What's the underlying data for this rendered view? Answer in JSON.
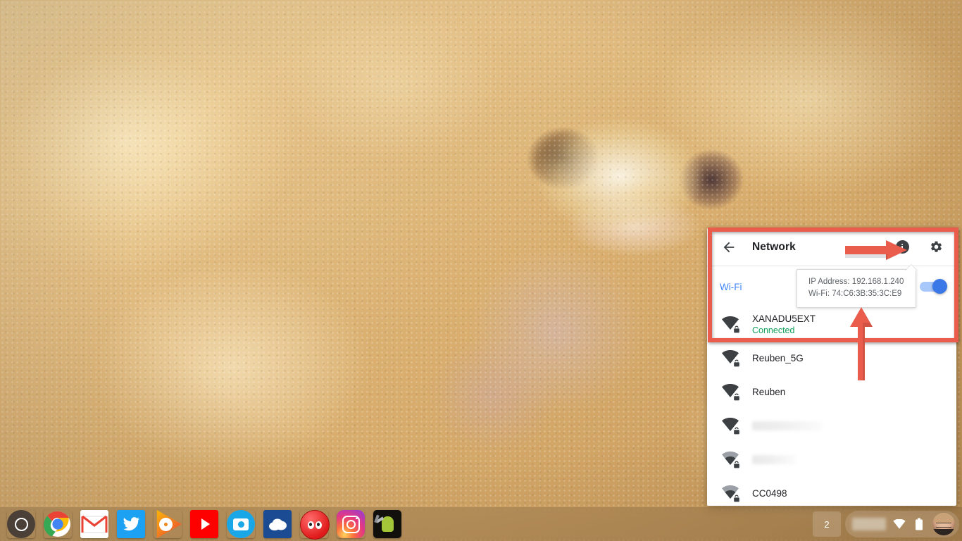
{
  "wallpaper": {
    "description": "blurred close-up photo of a pale gecko resting on golden sand"
  },
  "network_panel": {
    "header": {
      "back_label": "←",
      "title": "Network",
      "info_label": "i",
      "info_icon_name": "info-icon",
      "settings_icon_name": "gear-icon"
    },
    "wifi_section": {
      "label": "Wi-Fi",
      "toggle_state": "on",
      "toggle_color": "#3b78e7",
      "label_color": "#4285f4"
    },
    "tooltip": {
      "visible": true,
      "lines": [
        "IP Address:  192.168.1.240",
        "Wi-Fi:  74:C6:3B:35:3C:E9"
      ],
      "line1": "IP Address:  192.168.1.240",
      "line2": "Wi-Fi:  74:C6:3B:35:3C:E9"
    },
    "networks": [
      {
        "name": "XANADU5EXT",
        "status": "Connected",
        "secured": true,
        "signal": "full",
        "blurred": false
      },
      {
        "name": "Reuben_5G",
        "status": "",
        "secured": true,
        "signal": "full",
        "blurred": false
      },
      {
        "name": "Reuben",
        "status": "",
        "secured": true,
        "signal": "full",
        "blurred": false
      },
      {
        "name": "",
        "status": "",
        "secured": true,
        "signal": "full",
        "blurred": true,
        "blur_width": 100
      },
      {
        "name": "",
        "status": "",
        "secured": true,
        "signal": "medium",
        "blurred": true,
        "blur_width": 62
      },
      {
        "name": "CC0498",
        "status": "",
        "secured": true,
        "signal": "medium",
        "blurred": false
      }
    ],
    "status_color": "#0f9d58"
  },
  "annotations": {
    "color": "#ea5c4c",
    "highlight_box": {
      "target": "network-panel-header-and-wifi-rows"
    },
    "arrow_right": {
      "points_at": "info-icon"
    },
    "arrow_up": {
      "points_at": "ip-address-tooltip"
    }
  },
  "shelf": {
    "apps": [
      {
        "name": "launcher",
        "label": "Launcher"
      },
      {
        "name": "chrome",
        "label": "Google Chrome"
      },
      {
        "name": "gmail",
        "label": "Gmail"
      },
      {
        "name": "twitter",
        "label": "Twitter"
      },
      {
        "name": "play-music",
        "label": "Google Play Music"
      },
      {
        "name": "youtube",
        "label": "YouTube"
      },
      {
        "name": "camera",
        "label": "Camera"
      },
      {
        "name": "onedrive",
        "label": "OneDrive"
      },
      {
        "name": "red-ball",
        "label": "Red Ball"
      },
      {
        "name": "instagram",
        "label": "Instagram"
      },
      {
        "name": "android-game",
        "label": "Android Game"
      }
    ],
    "status": {
      "desk_count": "2",
      "clock": "",
      "wifi_icon_name": "wifi-icon",
      "battery_icon_name": "battery-icon",
      "avatar_name": "user-avatar"
    }
  }
}
